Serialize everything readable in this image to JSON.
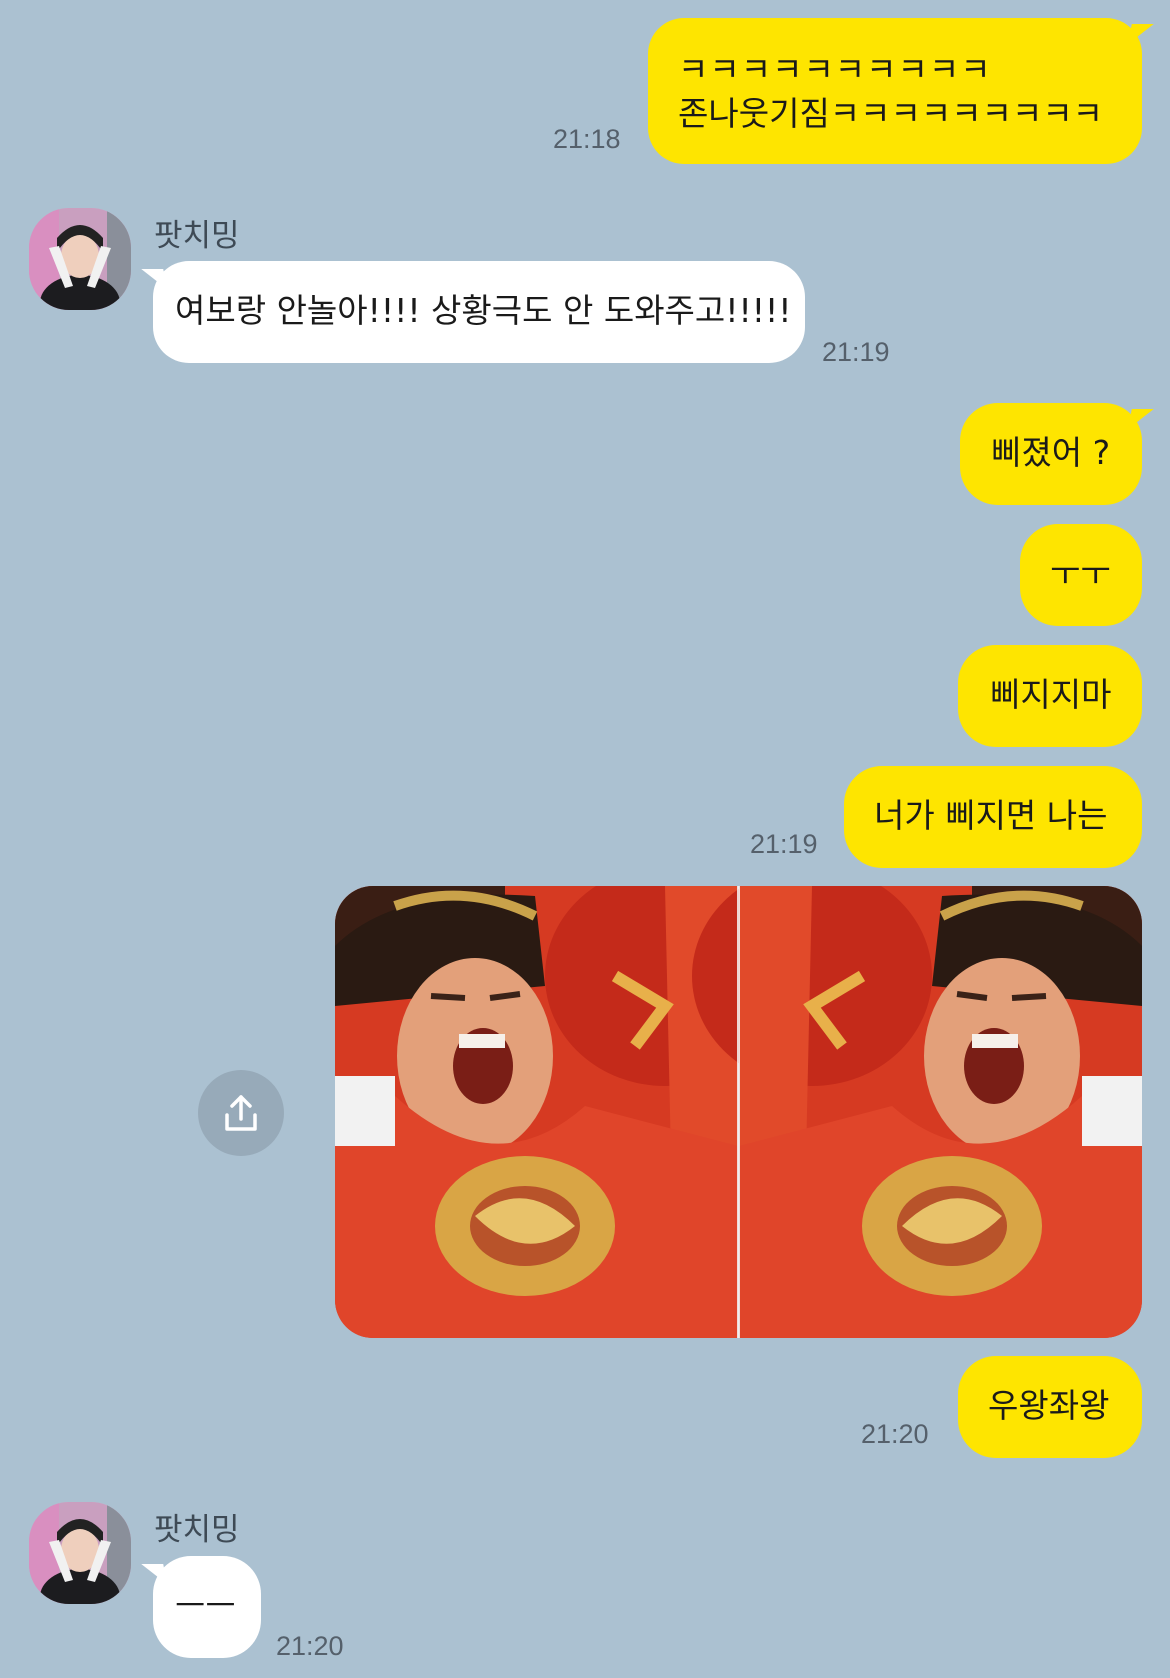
{
  "chat": {
    "messages": [
      {
        "from": "me",
        "lines": [
          "ㅋㅋㅋㅋㅋㅋㅋㅋㅋㅋ",
          "존나웃기짐ㅋㅋㅋㅋㅋㅋㅋㅋㅋ"
        ],
        "time": "21:18"
      },
      {
        "from": "them",
        "sender": "팟치밍",
        "text": "여보랑 안놀아!!!! 상황극도 안 도와주고!!!!!",
        "time": "21:19"
      },
      {
        "from": "me",
        "text": "삐졌어 ?"
      },
      {
        "from": "me",
        "text": "ㅜㅜ"
      },
      {
        "from": "me",
        "text": "삐지지마"
      },
      {
        "from": "me",
        "text": "너가 삐지면 나는",
        "time": "21:19"
      },
      {
        "from": "me",
        "image": "mirrored-king-meme"
      },
      {
        "from": "me",
        "text": "우왕좌왕",
        "time": "21:20"
      },
      {
        "from": "them",
        "sender": "팟치밍",
        "text": "ㅡㅡ",
        "time": "21:20"
      }
    ]
  },
  "colors": {
    "background": "#abc1d1",
    "my_bubble": "#fee500",
    "their_bubble": "#ffffff",
    "timestamp": "#55606b"
  }
}
